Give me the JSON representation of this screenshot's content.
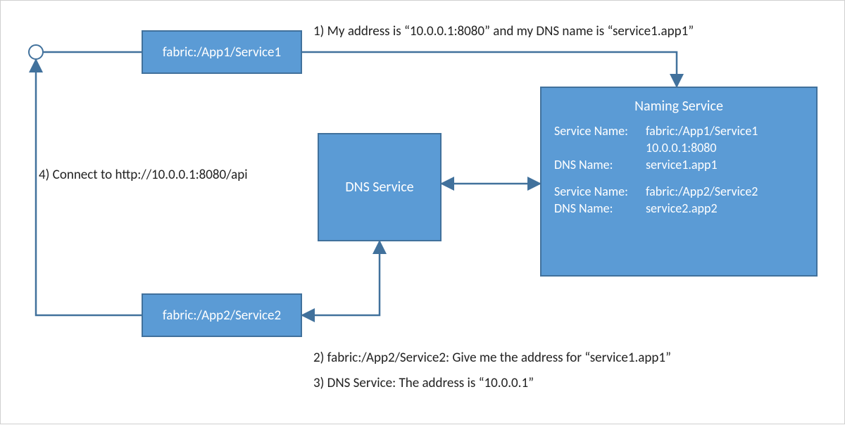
{
  "nodes": {
    "start_circle": "start-node",
    "service1": "fabric:/App1/Service1",
    "service2": "fabric:/App2/Service2",
    "dns": "DNS Service",
    "naming": {
      "title": "Naming Service",
      "rows": [
        {
          "label": "Service Name:",
          "value": "fabric:/App1/Service1"
        },
        {
          "label": "",
          "value": "10.0.0.1:8080"
        },
        {
          "label": "DNS Name:",
          "value": "service1.app1"
        }
      ],
      "rows2": [
        {
          "label": "Service Name:",
          "value": "fabric:/App2/Service2"
        },
        {
          "label": "DNS Name:",
          "value": "service2.app2"
        }
      ]
    }
  },
  "annotations": {
    "step1": "1) My address is “10.0.0.1:8080” and my DNS name is “service1.app1”",
    "step2": "2) fabric:/App2/Service2: Give me the address for “service1.app1”",
    "step3": "3) DNS Service: The address is “10.0.0.1”",
    "step4": "4) Connect to http://10.0.0.1:8080/api"
  },
  "colors": {
    "box_fill": "#5b9bd5",
    "box_border": "#41719c",
    "arrow": "#41719c",
    "text_dark": "#222222",
    "text_light": "#ffffff"
  },
  "edges": [
    {
      "from": "start-circle",
      "to": "service1",
      "arrow": "none",
      "note": ""
    },
    {
      "from": "service1",
      "to": "naming-service",
      "arrow": "end",
      "note_ref": "step1"
    },
    {
      "from": "dns-service",
      "to": "naming-service",
      "arrow": "both",
      "note": ""
    },
    {
      "from": "service2",
      "to": "dns-service",
      "arrow": "both-vertical",
      "note_ref": "step2 / step3"
    },
    {
      "from": "service2",
      "to": "start-circle",
      "arrow": "end",
      "note_ref": "step4"
    }
  ]
}
